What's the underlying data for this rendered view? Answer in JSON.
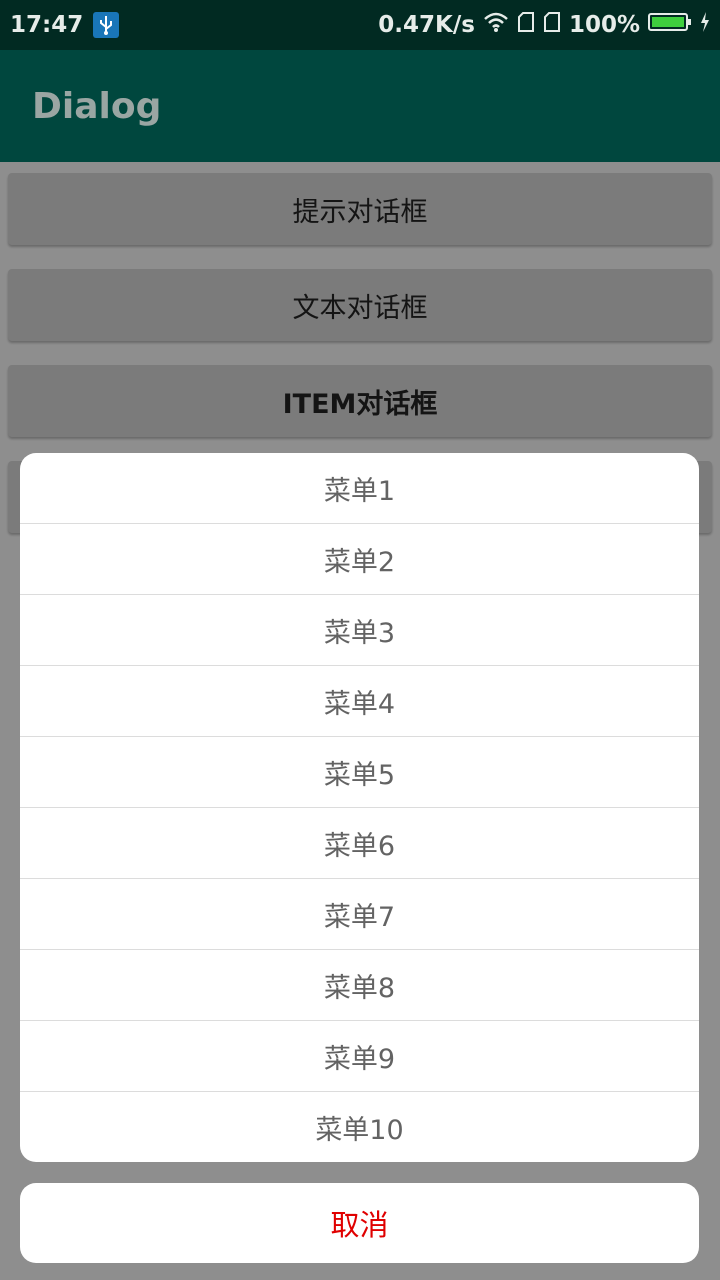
{
  "status_bar": {
    "time": "17:47",
    "speed": "0.47K/s",
    "battery": "100%",
    "icons": [
      "usb-icon",
      "wifi-icon",
      "sim1-icon",
      "sim2-icon",
      "battery-icon",
      "charging-icon"
    ]
  },
  "app_bar": {
    "title": "Dialog"
  },
  "buttons": [
    {
      "label": "提示对话框"
    },
    {
      "label": "文本对话框"
    },
    {
      "label": "ITEM对话框"
    }
  ],
  "menu": {
    "items": [
      "菜单1",
      "菜单2",
      "菜单3",
      "菜单4",
      "菜单5",
      "菜单6",
      "菜单7",
      "菜单8",
      "菜单9",
      "菜单10"
    ],
    "cancel_label": "取消"
  },
  "colors": {
    "app_bar": "#00473e",
    "status_bar": "#012a22",
    "cancel_text": "#e00000",
    "scrim": "#8e8e8e"
  }
}
